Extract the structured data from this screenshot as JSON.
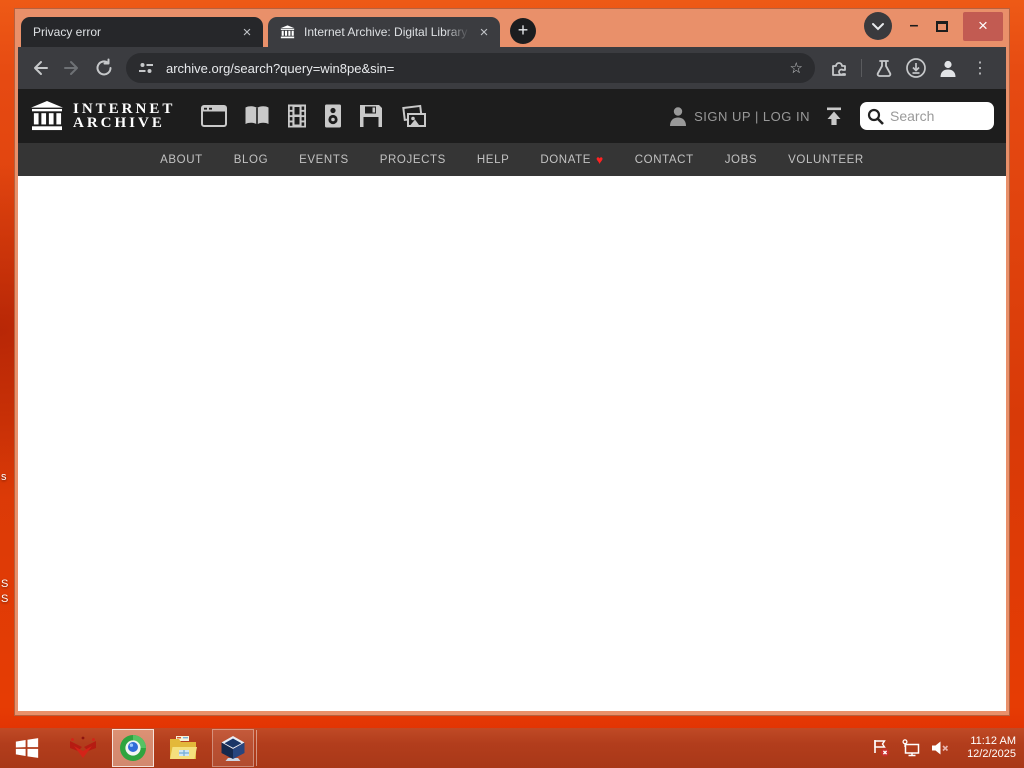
{
  "browser": {
    "tabs": [
      {
        "title": "Privacy error",
        "close_icon": "×"
      },
      {
        "title": "Internet Archive: Digital Library",
        "close_icon": "×"
      }
    ],
    "new_tab_icon": "+",
    "url": "archive.org/search?query=win8pe&sin=",
    "window_controls": {
      "minimize": "–",
      "close": "×"
    },
    "toolbar": {
      "bookmark_star": "☆",
      "menu_dots": "⋮"
    }
  },
  "archive": {
    "wordmark_line1": "INTERNET",
    "wordmark_line2": "ARCHIVE",
    "auth_text": "SIGN UP | LOG IN",
    "search_placeholder": "Search",
    "nav": [
      "ABOUT",
      "BLOG",
      "EVENTS",
      "PROJECTS",
      "HELP",
      "DONATE",
      "CONTACT",
      "JOBS",
      "VOLUNTEER"
    ],
    "donate_heart": "♥",
    "media_types": [
      "web",
      "texts",
      "video",
      "audio",
      "software",
      "images"
    ]
  },
  "taskbar": {
    "time": "11:12 AM",
    "date": "12/2/2025"
  },
  "desktop": {
    "icon_label_fragments": [
      "s",
      "S",
      "S"
    ]
  },
  "colors": {
    "titlebar": "#e9906a",
    "desktop_orange": "#e04a10",
    "taskbar_red": "#b5431f",
    "close_button_red": "#c25b52",
    "heart_red": "#ff2222",
    "archive_header_bg": "#1d1d1d",
    "archive_nav_bg": "#353535"
  }
}
